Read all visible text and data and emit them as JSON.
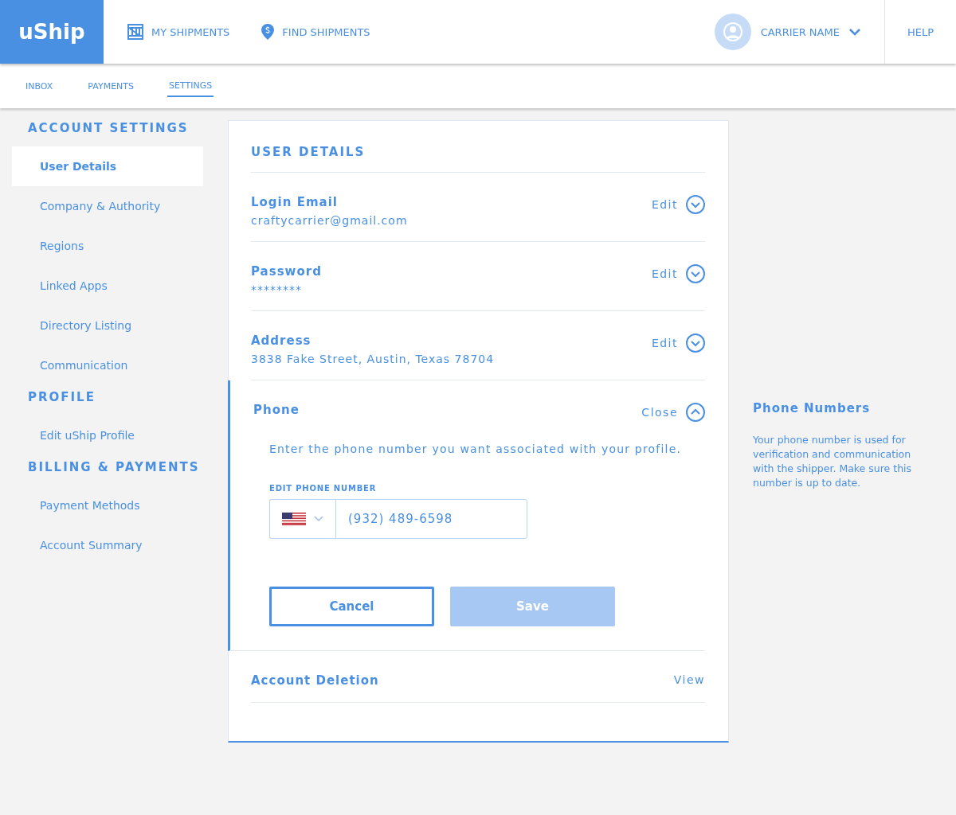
{
  "header": {
    "logo": "uShip",
    "nav": [
      {
        "label": "MY SHIPMENTS",
        "kind": "shipments"
      },
      {
        "label": "FIND SHIPMENTS",
        "kind": "find"
      }
    ],
    "user": "CARRIER NAME",
    "help": "HELP"
  },
  "subnav": [
    {
      "label": "INBOX",
      "selected": false
    },
    {
      "label": "PAYMENTS",
      "selected": false
    },
    {
      "label": "SETTINGS",
      "selected": true
    }
  ],
  "sidebar": [
    {
      "heading": "ACCOUNT SETTINGS",
      "items": [
        {
          "label": "User Details",
          "selected": true
        },
        {
          "label": "Company & Authority",
          "selected": false
        },
        {
          "label": "Regions",
          "selected": false
        },
        {
          "label": "Linked Apps",
          "selected": false
        },
        {
          "label": "Directory Listing",
          "selected": false
        },
        {
          "label": "Communication",
          "selected": false
        }
      ]
    },
    {
      "heading": "PROFILE",
      "items": [
        {
          "label": "Edit uShip Profile",
          "selected": false
        }
      ]
    },
    {
      "heading": "BILLING & PAYMENTS",
      "items": [
        {
          "label": "Payment Methods",
          "selected": false
        },
        {
          "label": "Account Summary",
          "selected": false
        }
      ]
    }
  ],
  "card": {
    "title": "USER DETAILS",
    "sections": [
      {
        "label": "Login Email",
        "value": "craftycarrier@gmail.com",
        "action": "Edit",
        "expanded": false,
        "kind": "toggle"
      },
      {
        "label": "Password",
        "value": "********",
        "action": "Edit",
        "expanded": false,
        "kind": "toggle"
      },
      {
        "label": "Address",
        "value": "3838 Fake Street, Austin, Texas 78704",
        "action": "Edit",
        "expanded": false,
        "kind": "toggle"
      },
      {
        "label": "Phone",
        "action": "Close",
        "expanded": true,
        "kind": "toggle",
        "instructions": "Enter the phone number you want associated with your profile.",
        "field_label": "EDIT PHONE NUMBER",
        "phone": "(932) 489-6598",
        "cancel": "Cancel",
        "save": {
          "label": "Save",
          "disabled": true
        }
      },
      {
        "label": "Account Deletion",
        "action": "View",
        "expanded": false,
        "kind": "link"
      }
    ]
  },
  "help_panel": {
    "title": "Phone Numbers",
    "text": "Your phone number is used for verification and communication with the shipper. Make sure this number is up to date."
  }
}
